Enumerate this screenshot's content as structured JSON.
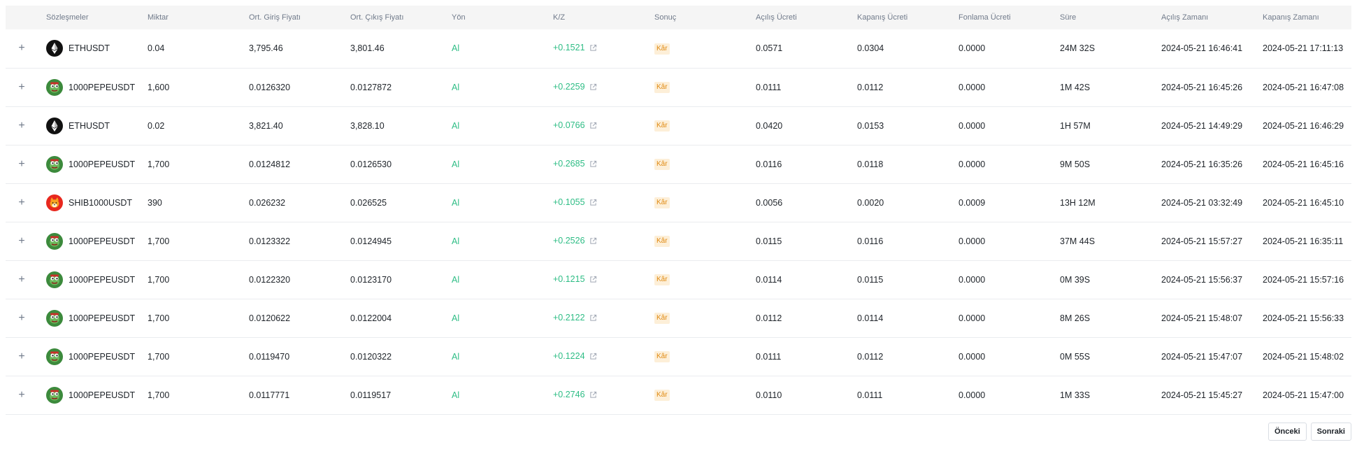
{
  "columns": {
    "contract": "Sözleşmeler",
    "amount": "Miktar",
    "avg_entry": "Ort. Giriş Fiyatı",
    "avg_exit": "Ort. Çıkış Fiyatı",
    "side": "Yön",
    "pnl": "K/Z",
    "result": "Sonuç",
    "open_fee": "Açılış Ücreti",
    "close_fee": "Kapanış Ücreti",
    "funding_fee": "Fonlama Ücreti",
    "duration": "Süre",
    "open_time": "Açılış Zamanı",
    "close_time": "Kapanış Zamanı"
  },
  "icons": {
    "expand": "plus-icon",
    "external": "external-link-icon",
    "eth": "ethereum-logo-icon",
    "pepe": "pepe-frog-logo-icon",
    "shib": "shiba-inu-logo-icon"
  },
  "colors": {
    "positive": "#2ebd85",
    "badge_text": "#e08a12",
    "badge_bg": "#fdefd8",
    "header_bg": "#f5f5f5"
  },
  "rows": [
    {
      "icon": "eth",
      "symbol": "ETHUSDT",
      "amount": "0.04",
      "entry": "3,795.46",
      "exit": "3,801.46",
      "side": "Al",
      "pnl": "+0.1521",
      "result": "Kâr",
      "open_fee": "0.0571",
      "close_fee": "0.0304",
      "funding_fee": "0.0000",
      "duration": "24M 32S",
      "open_time": "2024-05-21 16:46:41",
      "close_time": "2024-05-21 17:11:13"
    },
    {
      "icon": "pepe",
      "symbol": "1000PEPEUSDT",
      "amount": "1,600",
      "entry": "0.0126320",
      "exit": "0.0127872",
      "side": "Al",
      "pnl": "+0.2259",
      "result": "Kâr",
      "open_fee": "0.0111",
      "close_fee": "0.0112",
      "funding_fee": "0.0000",
      "duration": "1M 42S",
      "open_time": "2024-05-21 16:45:26",
      "close_time": "2024-05-21 16:47:08"
    },
    {
      "icon": "eth",
      "symbol": "ETHUSDT",
      "amount": "0.02",
      "entry": "3,821.40",
      "exit": "3,828.10",
      "side": "Al",
      "pnl": "+0.0766",
      "result": "Kâr",
      "open_fee": "0.0420",
      "close_fee": "0.0153",
      "funding_fee": "0.0000",
      "duration": "1H 57M",
      "open_time": "2024-05-21 14:49:29",
      "close_time": "2024-05-21 16:46:29"
    },
    {
      "icon": "pepe",
      "symbol": "1000PEPEUSDT",
      "amount": "1,700",
      "entry": "0.0124812",
      "exit": "0.0126530",
      "side": "Al",
      "pnl": "+0.2685",
      "result": "Kâr",
      "open_fee": "0.0116",
      "close_fee": "0.0118",
      "funding_fee": "0.0000",
      "duration": "9M 50S",
      "open_time": "2024-05-21 16:35:26",
      "close_time": "2024-05-21 16:45:16"
    },
    {
      "icon": "shib",
      "symbol": "SHIB1000USDT",
      "amount": "390",
      "entry": "0.026232",
      "exit": "0.026525",
      "side": "Al",
      "pnl": "+0.1055",
      "result": "Kâr",
      "open_fee": "0.0056",
      "close_fee": "0.0020",
      "funding_fee": "0.0009",
      "duration": "13H 12M",
      "open_time": "2024-05-21 03:32:49",
      "close_time": "2024-05-21 16:45:10"
    },
    {
      "icon": "pepe",
      "symbol": "1000PEPEUSDT",
      "amount": "1,700",
      "entry": "0.0123322",
      "exit": "0.0124945",
      "side": "Al",
      "pnl": "+0.2526",
      "result": "Kâr",
      "open_fee": "0.0115",
      "close_fee": "0.0116",
      "funding_fee": "0.0000",
      "duration": "37M 44S",
      "open_time": "2024-05-21 15:57:27",
      "close_time": "2024-05-21 16:35:11"
    },
    {
      "icon": "pepe",
      "symbol": "1000PEPEUSDT",
      "amount": "1,700",
      "entry": "0.0122320",
      "exit": "0.0123170",
      "side": "Al",
      "pnl": "+0.1215",
      "result": "Kâr",
      "open_fee": "0.0114",
      "close_fee": "0.0115",
      "funding_fee": "0.0000",
      "duration": "0M 39S",
      "open_time": "2024-05-21 15:56:37",
      "close_time": "2024-05-21 15:57:16"
    },
    {
      "icon": "pepe",
      "symbol": "1000PEPEUSDT",
      "amount": "1,700",
      "entry": "0.0120622",
      "exit": "0.0122004",
      "side": "Al",
      "pnl": "+0.2122",
      "result": "Kâr",
      "open_fee": "0.0112",
      "close_fee": "0.0114",
      "funding_fee": "0.0000",
      "duration": "8M 26S",
      "open_time": "2024-05-21 15:48:07",
      "close_time": "2024-05-21 15:56:33"
    },
    {
      "icon": "pepe",
      "symbol": "1000PEPEUSDT",
      "amount": "1,700",
      "entry": "0.0119470",
      "exit": "0.0120322",
      "side": "Al",
      "pnl": "+0.1224",
      "result": "Kâr",
      "open_fee": "0.0111",
      "close_fee": "0.0112",
      "funding_fee": "0.0000",
      "duration": "0M 55S",
      "open_time": "2024-05-21 15:47:07",
      "close_time": "2024-05-21 15:48:02"
    },
    {
      "icon": "pepe",
      "symbol": "1000PEPEUSDT",
      "amount": "1,700",
      "entry": "0.0117771",
      "exit": "0.0119517",
      "side": "Al",
      "pnl": "+0.2746",
      "result": "Kâr",
      "open_fee": "0.0110",
      "close_fee": "0.0111",
      "funding_fee": "0.0000",
      "duration": "1M 33S",
      "open_time": "2024-05-21 15:45:27",
      "close_time": "2024-05-21 15:47:00"
    }
  ],
  "pagination": {
    "prev_label": "Önceki",
    "next_label": "Sonraki"
  }
}
